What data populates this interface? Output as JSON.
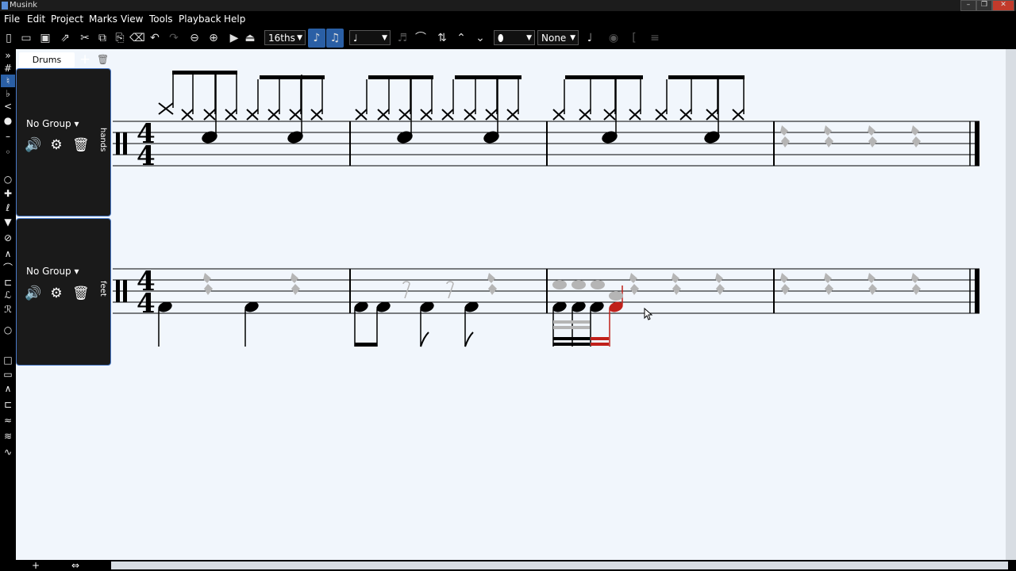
{
  "app": {
    "title": "Musink"
  },
  "window_controls": {
    "minimize": "–",
    "maximize": "❐",
    "close": "✕"
  },
  "menu": [
    "File",
    "Edit",
    "Project",
    "Marks",
    "View",
    "Tools",
    "Playback",
    "Help"
  ],
  "toolbar": {
    "note_value": "16ths",
    "duration_glyph": "♩",
    "notehead_glyph": "⬮",
    "articulation": "None"
  },
  "panel": {
    "tab_label": "Drums",
    "add_glyph": "+",
    "delete_glyph": "🗑",
    "staves": [
      {
        "label": "hands",
        "group": "No Group"
      },
      {
        "label": "feet",
        "group": "No Group"
      }
    ]
  },
  "score": {
    "time_signature_top": "4",
    "time_signature_bottom": "4"
  },
  "bottom": {
    "add": "+",
    "resize": "⇔"
  },
  "colors": {
    "selection": "#2a5fa5",
    "highlight_note": "#c0201a",
    "ghost_note": "#b5b5b5"
  }
}
